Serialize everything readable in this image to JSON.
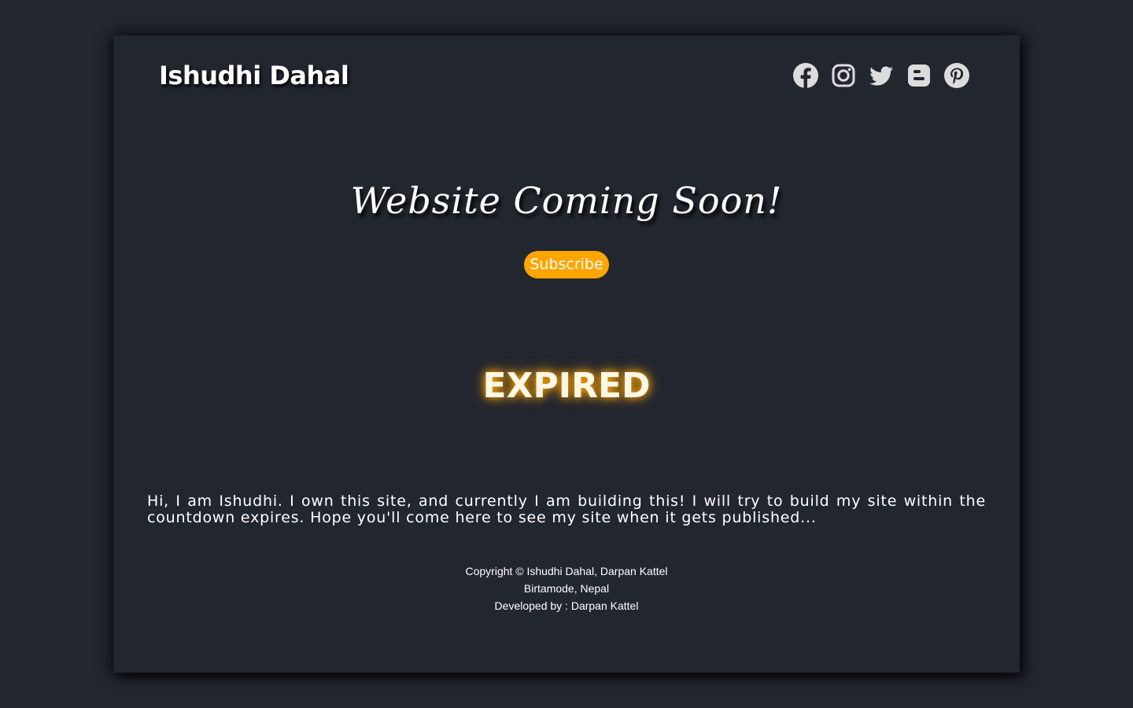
{
  "header": {
    "brand": "Ishudhi Dahal",
    "social_icons": [
      "facebook-icon",
      "instagram-icon",
      "twitter-icon",
      "blogger-icon",
      "pinterest-icon"
    ]
  },
  "hero": {
    "headline": "Website Coming Soon!",
    "subscribe_label": "Subscribe",
    "countdown_text": "EXPIRED"
  },
  "about": {
    "text": "Hi, I am Ishudhi. I own this site, and currently I am building this! I will try to build my site within the countdown expires. Hope you'll come here to see my site when it gets published..."
  },
  "footer": {
    "copyright": "Copyright © Ishudhi Dahal, Darpan Kattel",
    "location": "Birtamode, Nepal",
    "developer": "Developed by : Darpan Kattel"
  },
  "colors": {
    "background": "#22262f",
    "accent": "#ffa500",
    "icon": "#dcdcdc",
    "text": "#ffffff"
  }
}
